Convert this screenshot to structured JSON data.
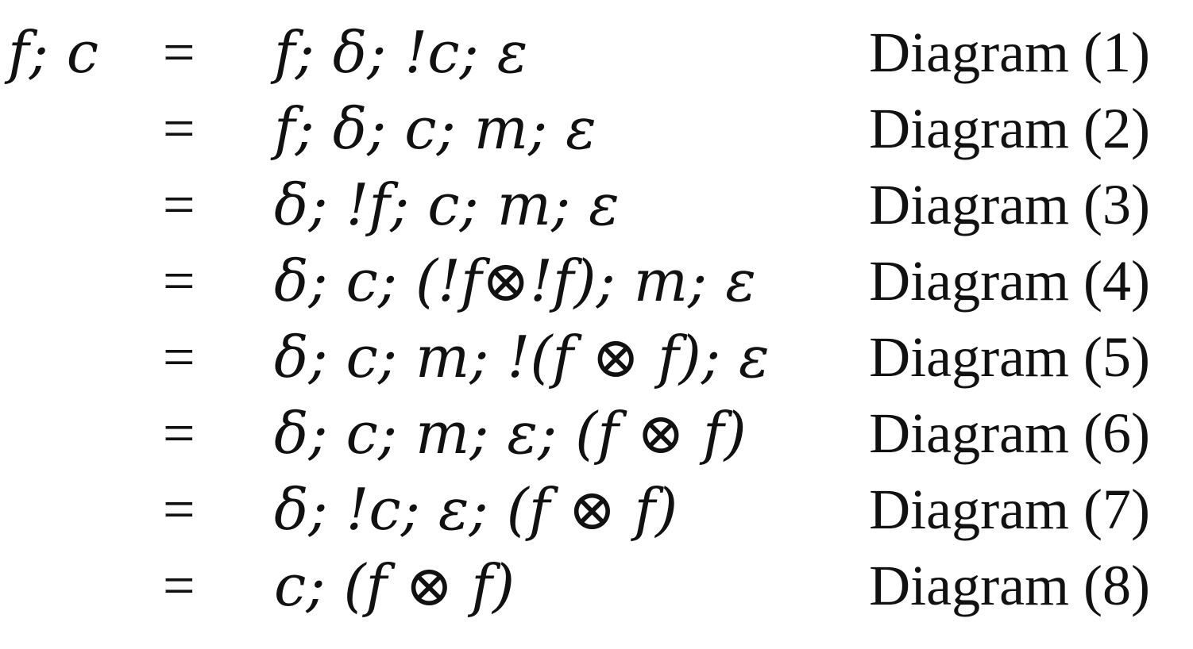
{
  "derivation": {
    "lhs": "f; c",
    "rows": [
      {
        "relation": "=",
        "expression": "f; δ; !c; ε",
        "label": "Diagram (1)"
      },
      {
        "relation": "=",
        "expression": "f; δ; c; m; ε",
        "label": "Diagram (2)"
      },
      {
        "relation": "=",
        "expression": "δ; !f; c; m; ε",
        "label": "Diagram (3)"
      },
      {
        "relation": "=",
        "expression": "δ; c; (!f⊗!f); m; ε",
        "label": "Diagram (4)"
      },
      {
        "relation": "=",
        "expression": "δ; c; m; !(f ⊗ f); ε",
        "label": "Diagram (5)"
      },
      {
        "relation": "=",
        "expression": "δ; c; m; ε; (f ⊗ f)",
        "label": "Diagram (6)"
      },
      {
        "relation": "=",
        "expression": "δ; !c; ε; (f ⊗ f)",
        "label": "Diagram (7)"
      },
      {
        "relation": "=",
        "expression": "c; (f ⊗ f)",
        "label": "Diagram (8)"
      }
    ]
  }
}
